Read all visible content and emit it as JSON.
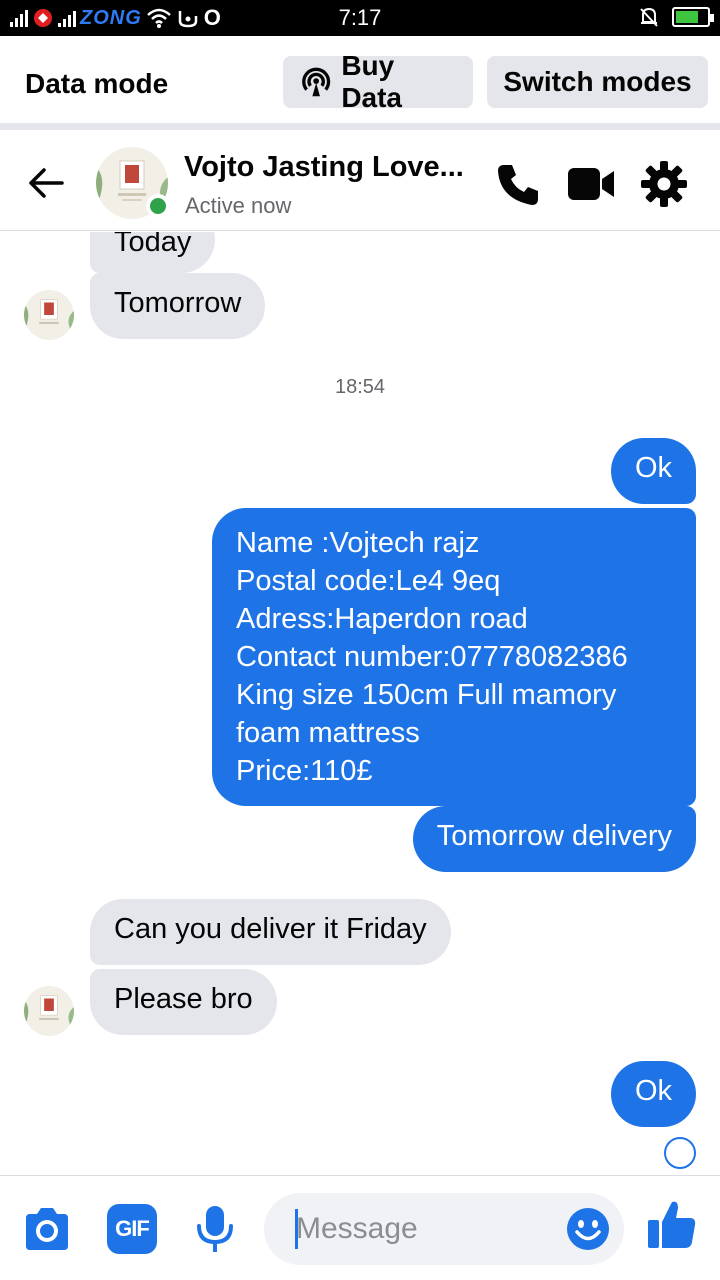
{
  "status_bar": {
    "carrier": "ZONG",
    "time": "7:17",
    "indicator": "O",
    "icons": [
      "signal-icon",
      "vpn-icon",
      "wifi-icon",
      "hotspot-icon",
      "mute-icon",
      "battery-icon"
    ]
  },
  "data_mode_bar": {
    "label": "Data mode",
    "buy_data": "Buy Data",
    "switch_modes": "Switch modes"
  },
  "header": {
    "contact_name": "Vojto Jasting Love...",
    "status": "Active now",
    "icons": [
      "back-arrow-icon",
      "phone-icon",
      "video-camera-icon",
      "gear-icon"
    ]
  },
  "chat": {
    "messages_in_top": [
      "Today",
      "Tomorrow"
    ],
    "timestamp": "18:54",
    "message_out_ok": "Ok",
    "details_lines": [
      "Name :Vojtech rajz",
      "Postal code:Le4 9eq",
      "Adress:Haperdon road",
      "Contact number:07778082386",
      "King size 150cm Full mamory",
      "foam mattress",
      "Price:110£"
    ],
    "message_out_delivery": "Tomorrow delivery",
    "messages_in_bottom": [
      "Can you deliver it Friday",
      "Please bro"
    ],
    "message_out_last": "Ok"
  },
  "composer": {
    "placeholder": "Message",
    "gif_label": "GIF",
    "icons": [
      "camera-icon",
      "gif-icon",
      "microphone-icon",
      "emoji-icon",
      "thumbs-up-icon"
    ]
  },
  "colors": {
    "accent": "#1e74e6",
    "incoming_bubble": "#e4e6eb",
    "online": "#31a24c"
  }
}
